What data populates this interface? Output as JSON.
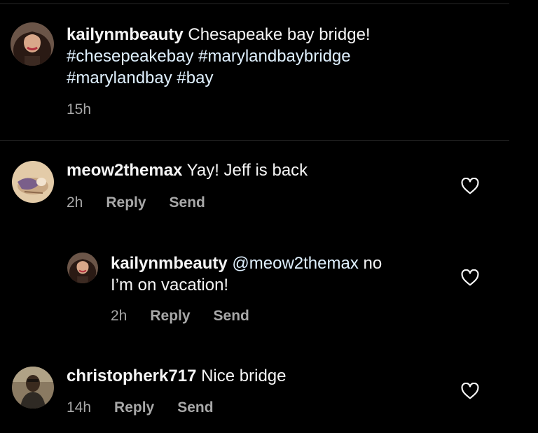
{
  "caption": {
    "username": "kailynmbeauty",
    "text": "Chesapeake bay bridge!",
    "hashtags_line1": "#chesepeakebay #marylandbaybridge",
    "hashtags_line2": "#marylandbay #bay",
    "time": "15h"
  },
  "comments": [
    {
      "username": "meow2themax",
      "text": "Yay! Jeff is back",
      "time": "2h",
      "reply_label": "Reply",
      "send_label": "Send"
    },
    {
      "username": "kailynmbeauty",
      "mention": "@meow2themax",
      "text_line1": "no",
      "text_line2": "I’m on vacation!",
      "time": "2h",
      "reply_label": "Reply",
      "send_label": "Send"
    },
    {
      "username": "christopherk717",
      "text": "Nice bridge",
      "time": "14h",
      "reply_label": "Reply",
      "send_label": "Send"
    }
  ],
  "icons": {
    "like": "heart-outline-icon"
  },
  "colors": {
    "background": "#000000",
    "text": "#f5f5f5",
    "secondary": "#a8a8a8",
    "link": "#e0f1ff"
  }
}
